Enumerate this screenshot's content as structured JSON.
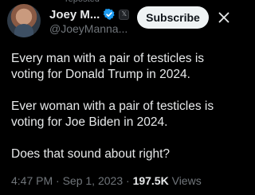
{
  "header": {
    "repost_label": "reposted",
    "display_name": "Joey M...",
    "handle": "@JoeyManna...",
    "subscribe_label": "Subscribe",
    "verified_color": "#1d9bf0",
    "icons": [
      "verified-badge-icon",
      "affiliation-badge-icon",
      "close-icon"
    ]
  },
  "tweet": {
    "paragraphs": [
      "Every man with a pair of testicles is voting for Donald Trump in 2024.",
      "Ever woman with a pair of testicles is voting for Joe Biden in 2024.",
      "Does that sound about right?"
    ]
  },
  "meta": {
    "time": "4:47 PM",
    "separator": "·",
    "date": "Sep 1, 2023",
    "views_count": "197.5K",
    "views_label": "Views"
  }
}
